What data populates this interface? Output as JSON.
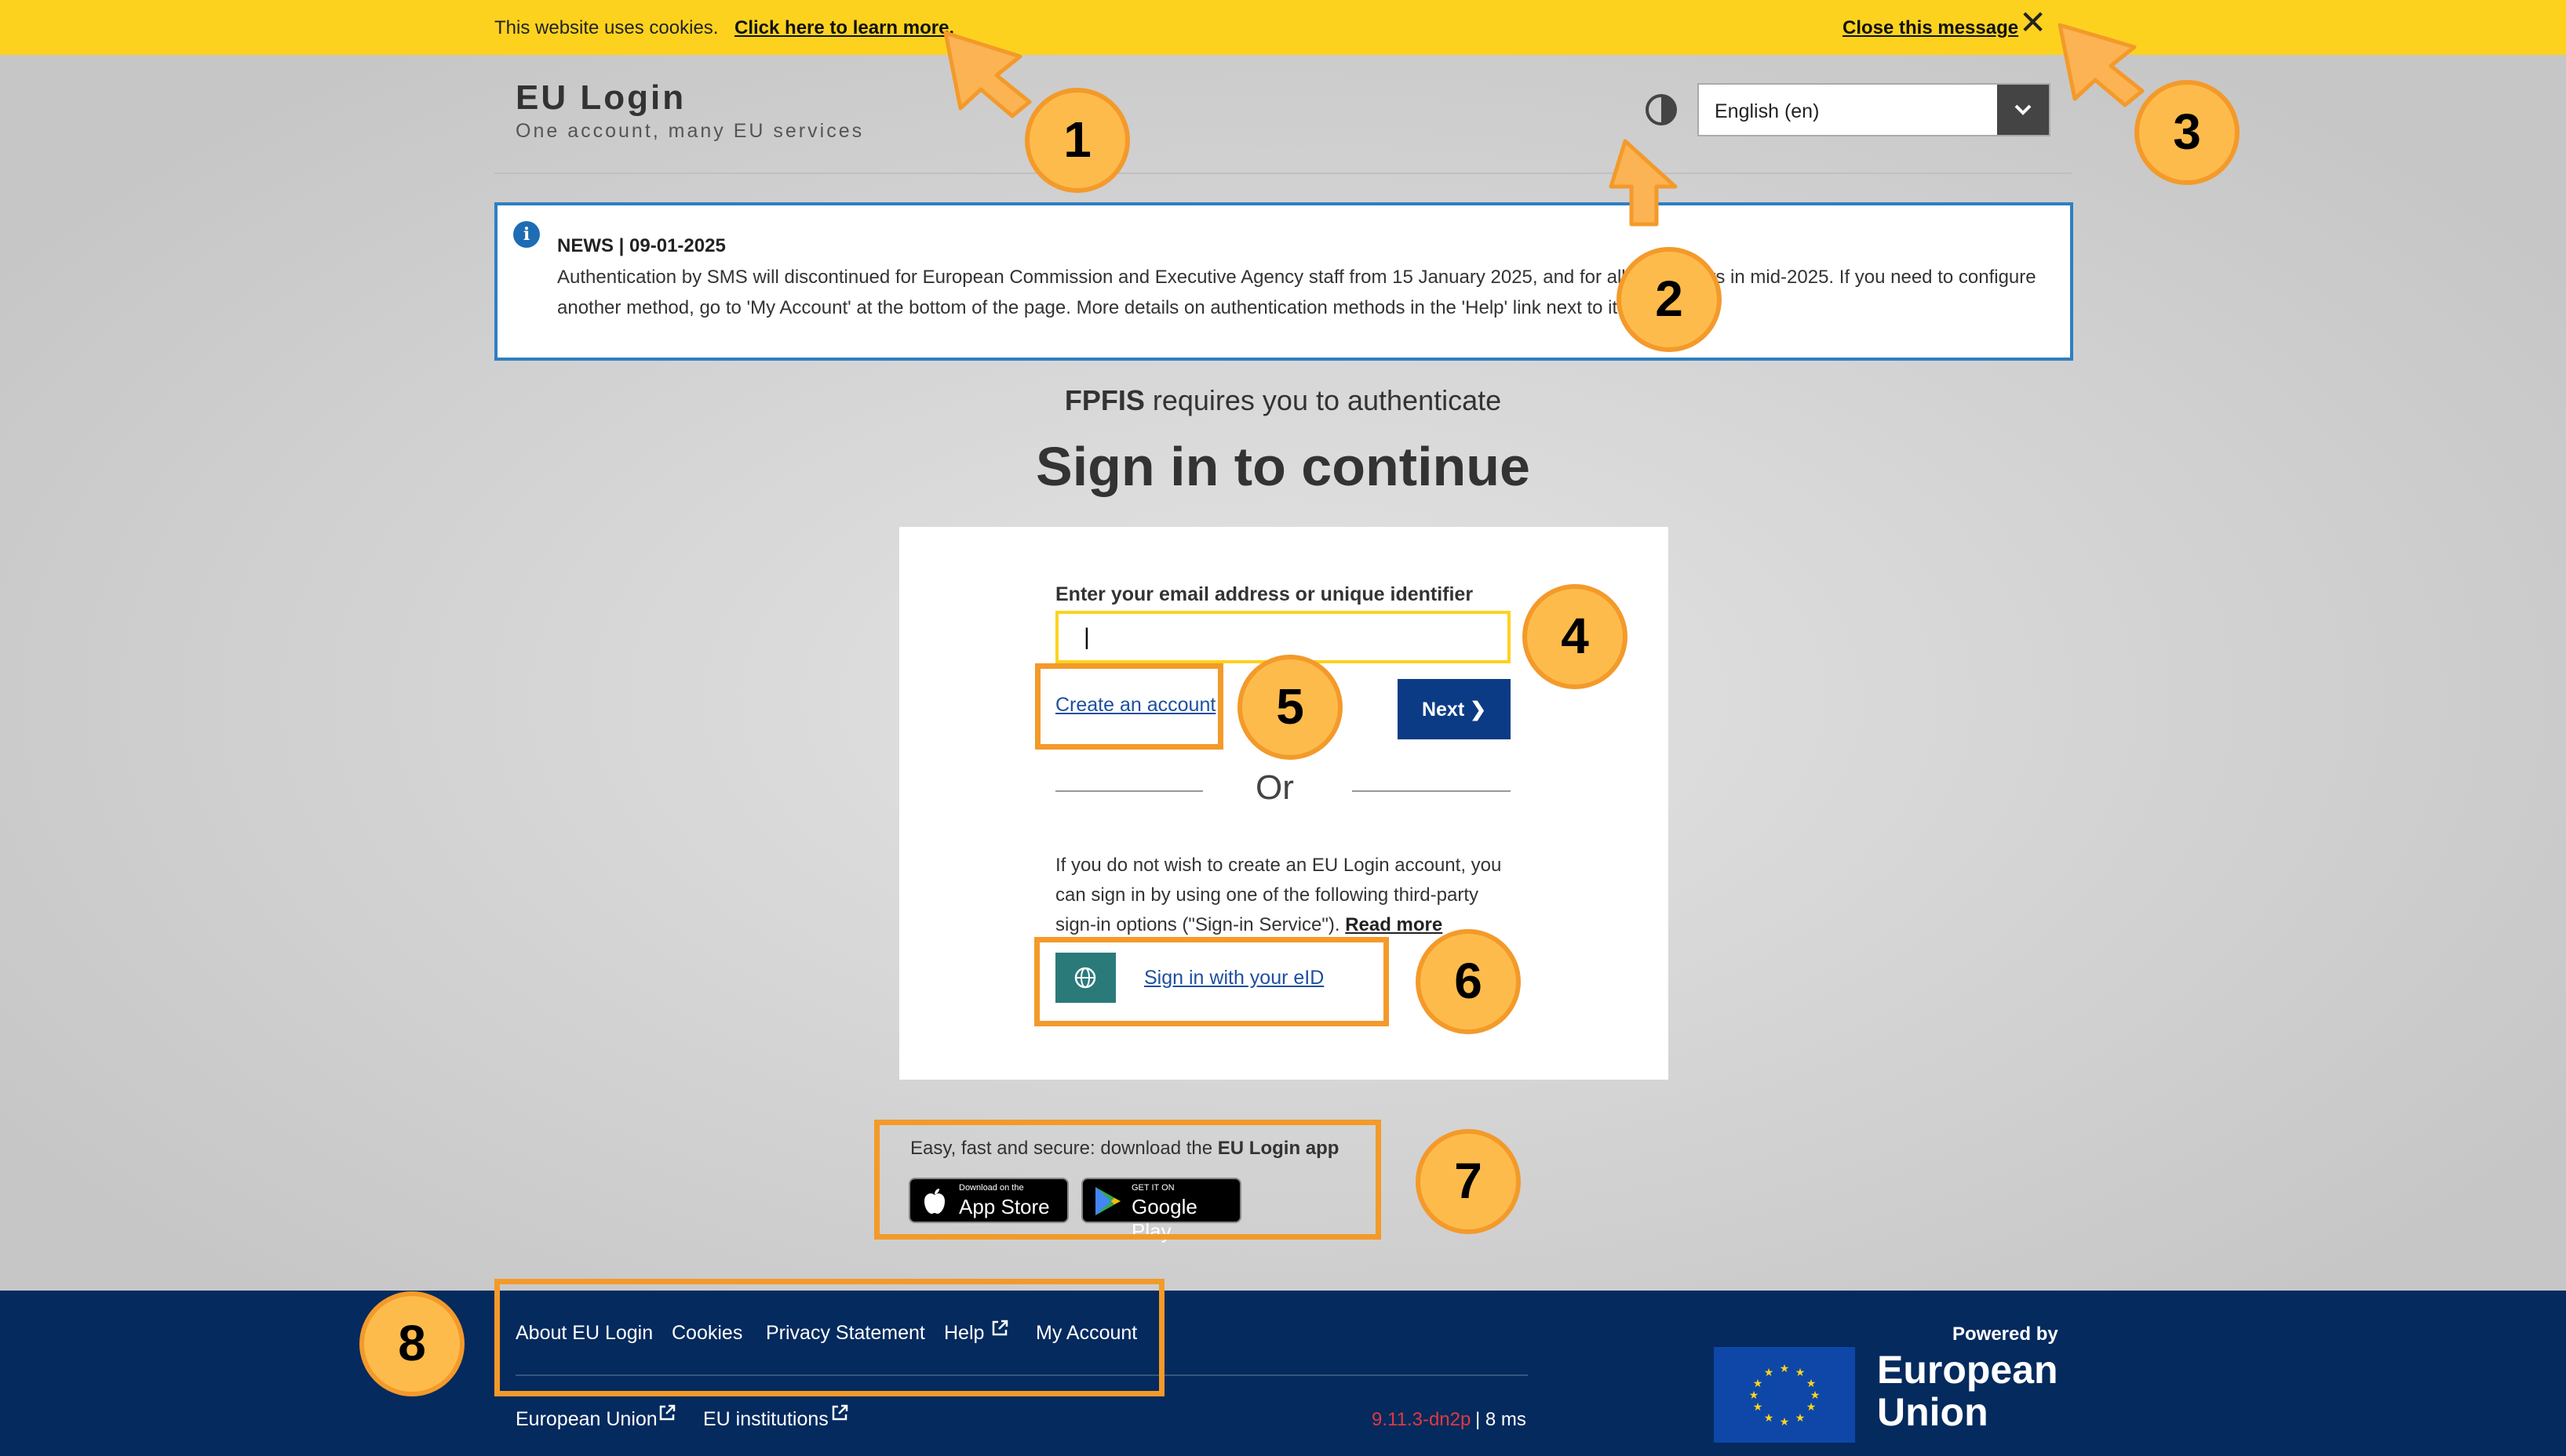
{
  "cookie_bar": {
    "text": "This website uses cookies.",
    "learn_more": "Click here to learn more.",
    "close": "Close this message"
  },
  "header": {
    "title": "EU Login",
    "subtitle": "One account, many EU services",
    "language": "English (en)"
  },
  "news": {
    "title": "NEWS | 09-01-2025",
    "body": "Authentication by SMS will discontinued for European Commission and Executive Agency staff from 15 January 2025, and for all other users in mid-2025. If you need to configure another method, go to 'My Account' at the bottom of the page. More details on authentication methods in the 'Help' link next to it."
  },
  "auth": {
    "service": "FPFIS",
    "requires": " requires you to authenticate",
    "title": "Sign in to continue"
  },
  "form": {
    "email_label": "Enter your email address or unique identifier",
    "email_value": "|",
    "create_account": "Create an account",
    "next": "Next ❯",
    "or": "Or",
    "thirdparty_text": "If you do not wish to create an EU Login account, you can sign in by using one of the following third-party sign-in options (\"Sign-in Service\").",
    "read_more": "Read more",
    "eid": "Sign in with your eID"
  },
  "app": {
    "text": "Easy, fast and secure: download the ",
    "app_name": "EU Login app",
    "appstore_small": "Download on the",
    "appstore_big": "App Store",
    "google_small": "GET IT ON",
    "google_big": "Google Play"
  },
  "footer": {
    "links": [
      "About EU Login",
      "Cookies",
      "Privacy Statement",
      "Help",
      "My Account"
    ],
    "bottom_links": [
      "European Union",
      "EU institutions"
    ],
    "version": "9.11.3-dn2p",
    "timing": "| 8 ms",
    "powered_by": "Powered by",
    "eu_name": "European Union"
  },
  "callouts": [
    "1",
    "2",
    "3",
    "4",
    "5",
    "6",
    "7",
    "8"
  ],
  "colors": {
    "cookie_bar": "#fdd21f",
    "annotation": "#f39a2a",
    "footer": "#042a5e",
    "next_button": "#0c3b85"
  }
}
